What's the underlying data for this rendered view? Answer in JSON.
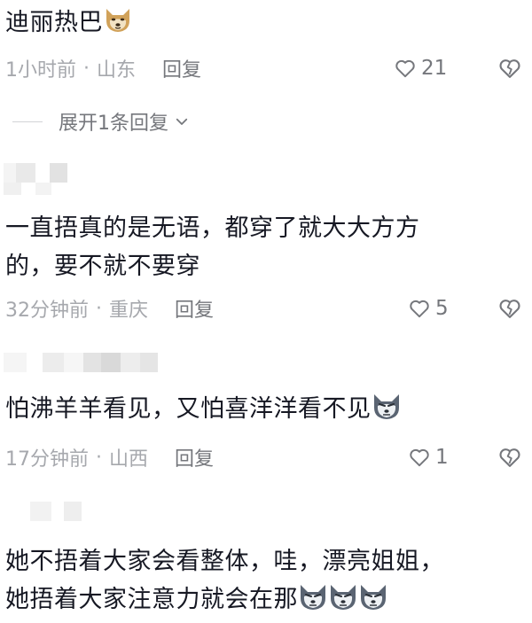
{
  "comments": [
    {
      "text": "迪丽热巴",
      "time": "1小时前",
      "location": "山东",
      "reply_label": "回复",
      "likes": "21",
      "emoji": "dog-face-emoji"
    },
    {
      "text_line1": "一直捂真的是无语，都穿了就大大方方",
      "text_line2": "的，要不就不要穿",
      "time": "32分钟前",
      "location": "重庆",
      "reply_label": "回复",
      "likes": "5"
    },
    {
      "text": "怕沸羊羊看见，又怕喜洋洋看不见",
      "time": "17分钟前",
      "location": "山西",
      "reply_label": "回复",
      "likes": "1",
      "emoji": "husky-face-emoji"
    },
    {
      "text_line1": "她不捂着大家会看整体，哇，漂亮姐姐，",
      "text_line2": "她捂着大家注意力就会在那",
      "emoji": "husky-face-emoji",
      "emoji_count": 3
    }
  ],
  "expand_replies": "展开1条回复",
  "meta_separator": "·",
  "colors": {
    "text": "#161823",
    "meta": "#a6a8ad",
    "action": "#75777c"
  }
}
